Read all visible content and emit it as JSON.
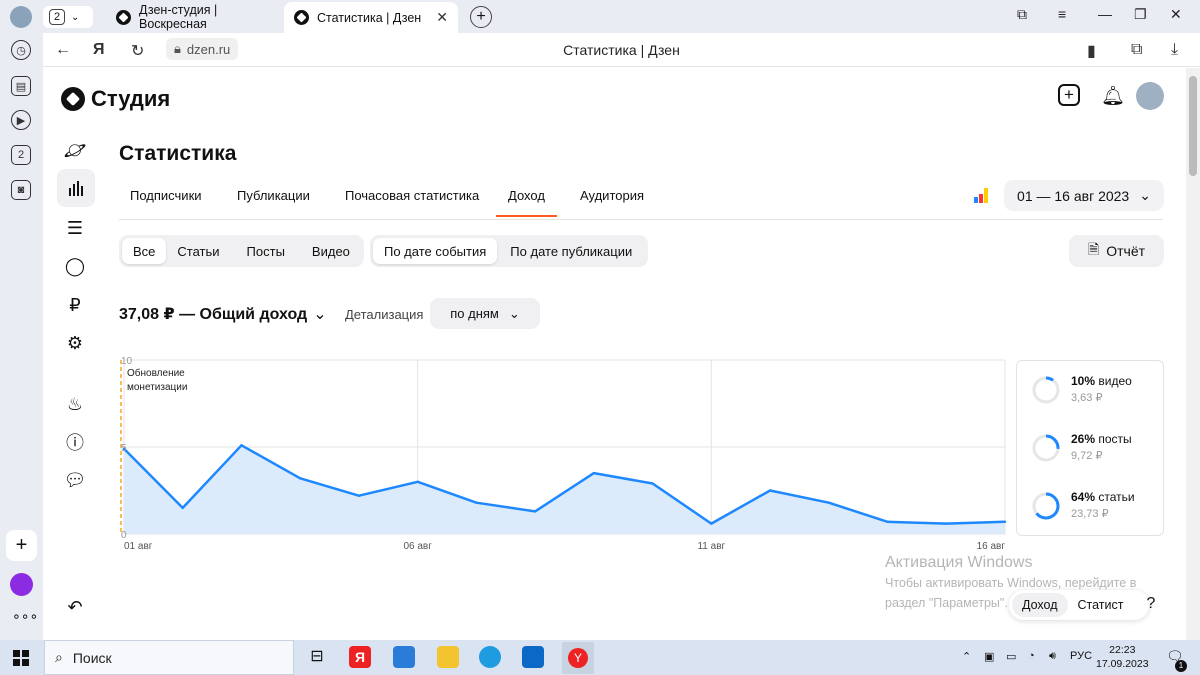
{
  "browser": {
    "tab_count": "2",
    "tabs": [
      {
        "title": "Дзен-студия | Воскресная"
      },
      {
        "title": "Статистика | Дзен"
      }
    ],
    "url": "dzen.ru",
    "page_title": "Статистика | Дзен"
  },
  "studio": {
    "logo_text": "Студия",
    "page_heading": "Статистика",
    "tabs": [
      {
        "label": "Подписчики"
      },
      {
        "label": "Публикации"
      },
      {
        "label": "Почасовая статистика"
      },
      {
        "label": "Доход",
        "active": true
      },
      {
        "label": "Аудитория"
      }
    ],
    "date_range": "01 — 16 авг 2023",
    "content_filter": [
      {
        "label": "Все",
        "selected": true
      },
      {
        "label": "Статьи"
      },
      {
        "label": "Посты"
      },
      {
        "label": "Видео"
      }
    ],
    "date_filter": [
      {
        "label": "По дате события",
        "selected": true
      },
      {
        "label": "По дате публикации"
      }
    ],
    "report_label": "Отчёт",
    "income_total": "37,08 ₽ — Общий доход",
    "detail_label": "Детализация",
    "detail_value": "по дням",
    "chart_annotation": "Обновление монетизации",
    "breakdown": [
      {
        "pct": "10%",
        "type": "видео",
        "amount": "3,63 ₽",
        "fraction": 0.1
      },
      {
        "pct": "26%",
        "type": "посты",
        "amount": "9,72 ₽",
        "fraction": 0.26
      },
      {
        "pct": "64%",
        "type": "статьи",
        "amount": "23,73 ₽",
        "fraction": 0.64
      }
    ]
  },
  "chart_data": {
    "type": "area",
    "x": [
      "01 авг",
      "02 авг",
      "03 авг",
      "04 авг",
      "05 авг",
      "06 авг",
      "07 авг",
      "08 авг",
      "09 авг",
      "10 авг",
      "11 авг",
      "12 авг",
      "13 авг",
      "14 авг",
      "15 авг",
      "16 авг"
    ],
    "values": [
      4.9,
      1.5,
      5.1,
      3.2,
      2.2,
      3.0,
      1.8,
      1.3,
      3.5,
      2.9,
      0.6,
      2.5,
      1.8,
      0.7,
      0.6,
      0.7
    ],
    "xticks": [
      "01 авг",
      "06 авг",
      "11 авг",
      "16 авг"
    ],
    "yticks": [
      "10",
      "5",
      "0"
    ],
    "ylim": [
      0,
      10
    ],
    "grid": true,
    "line_color": "#1e88ff",
    "fill_color": "#dcebfb"
  },
  "floating": {
    "pill_items": [
      {
        "label": "Доход",
        "selected": true
      },
      {
        "label": "Статист"
      }
    ],
    "help": "?"
  },
  "watermark": {
    "line1": "Активация Windows",
    "line2": "Чтобы активировать Windows, перейдите в",
    "line3": "раздел \"Параметры\"."
  },
  "taskbar": {
    "search_label": "Поиск",
    "lang": "РУС",
    "time": "22:23",
    "date": "17.09.2023",
    "notifications": "1"
  }
}
